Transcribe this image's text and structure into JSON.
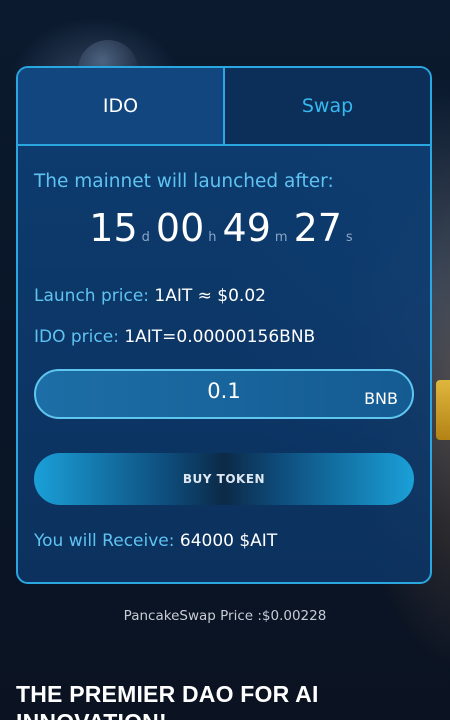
{
  "tabs": {
    "ido_label": "IDO",
    "swap_label": "Swap"
  },
  "countdown": {
    "label": "The mainnet will launched after:",
    "days": "15",
    "days_unit": "d",
    "hours": "00",
    "hours_unit": "h",
    "minutes": "49",
    "minutes_unit": "m",
    "seconds": "27",
    "seconds_unit": "s"
  },
  "launch_price": {
    "label": "Launch price:",
    "value": "1AIT ≈ $0.02"
  },
  "ido_price": {
    "label": "IDO price:",
    "value": "1AIT=0.00000156BNB"
  },
  "amount_input": {
    "value": "0.1",
    "currency": "BNB"
  },
  "buy_button_label": "BUY TOKEN",
  "receive": {
    "label": "You will Receive:",
    "value": "64000 $AIT"
  },
  "pancake_price": "PancakeSwap Price :$0.00228",
  "headline": "THE PREMIER DAO FOR AI INNOVATION!",
  "colors": {
    "accent": "#2aa6e0",
    "label_blue": "#5fc3f2",
    "card_bg": "#0e4076",
    "page_bg": "#0a1526"
  }
}
